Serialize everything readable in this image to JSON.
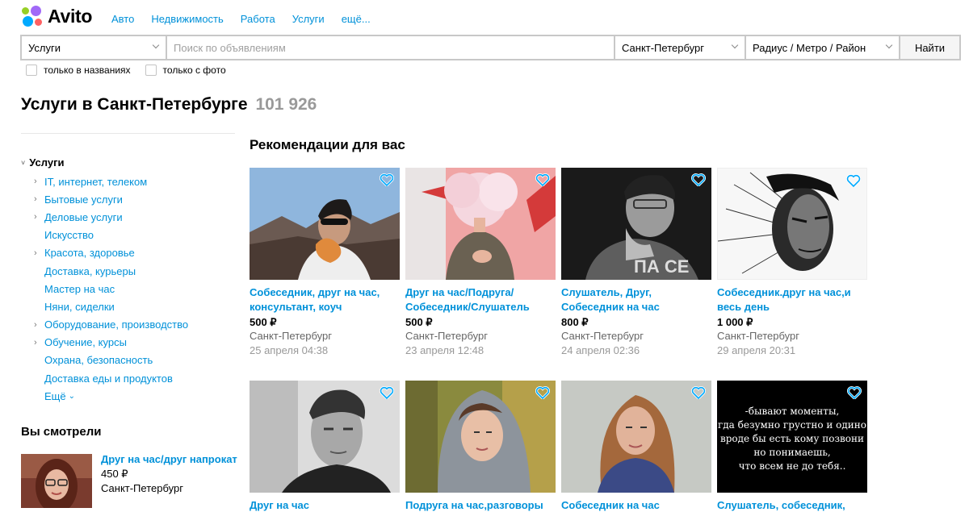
{
  "brand": {
    "name": "Avito"
  },
  "nav": [
    "Авто",
    "Недвижимость",
    "Работа",
    "Услуги",
    "ещё..."
  ],
  "search": {
    "category": "Услуги",
    "placeholder": "Поиск по объявлениям",
    "city": "Санкт-Петербург",
    "radius": "Радиус / Метро / Район",
    "button": "Найти"
  },
  "filters": {
    "names_only": "только в названиях",
    "with_photo": "только с фото"
  },
  "page": {
    "title": "Услуги в Санкт-Петербурге",
    "count": "101 926"
  },
  "sidebar": {
    "root": "Услуги",
    "items": [
      {
        "label": "IT, интернет, телеком",
        "arrow": true
      },
      {
        "label": "Бытовые услуги",
        "arrow": true
      },
      {
        "label": "Деловые услуги",
        "arrow": true
      },
      {
        "label": "Искусство",
        "arrow": false
      },
      {
        "label": "Красота, здоровье",
        "arrow": true
      },
      {
        "label": "Доставка, курьеры",
        "arrow": false
      },
      {
        "label": "Мастер на час",
        "arrow": false
      },
      {
        "label": "Няни, сиделки",
        "arrow": false
      },
      {
        "label": "Оборудование, производство",
        "arrow": true
      },
      {
        "label": "Обучение, курсы",
        "arrow": true
      },
      {
        "label": "Охрана, безопасность",
        "arrow": false
      },
      {
        "label": "Доставка еды и продуктов",
        "arrow": false
      }
    ],
    "more": "Ещё"
  },
  "viewed": {
    "heading": "Вы смотрели",
    "item": {
      "title": "Друг на час/друг напрокат",
      "price": "450 ₽",
      "city": "Санкт-Петербург"
    }
  },
  "recommendations": {
    "heading": "Рекомендации для вас",
    "row1": [
      {
        "title": "Собеседник, друг на час, консультант, коуч",
        "price": "500 ₽",
        "city": "Санкт-Петербург",
        "date": "25 апреля 04:38"
      },
      {
        "title": "Друг на час/Подруга/ Собеседник/Слушатель",
        "price": "500 ₽",
        "city": "Санкт-Петербург",
        "date": "23 апреля 12:48"
      },
      {
        "title": "Слушатель, Друг, Собеседник на час",
        "price": "800 ₽",
        "city": "Санкт-Петербург",
        "date": "24 апреля 02:36"
      },
      {
        "title": "Собеседник.друг на час,и весь день",
        "price": "1 000 ₽",
        "city": "Санкт-Петербург",
        "date": "29 апреля 20:31"
      }
    ],
    "row2": [
      {
        "title": "Друг на час"
      },
      {
        "title": "Подруга на час,разговоры"
      },
      {
        "title": "Собеседник на час"
      },
      {
        "title": "Слушатель, собеседник,",
        "quote": [
          "-бывают моменты,",
          "гда безумно грустно и одино",
          "вроде бы есть кому позвони",
          "но понимаешь,",
          "что всем не до тебя.."
        ]
      }
    ]
  },
  "colors": {
    "link": "#0091d9",
    "muted": "#999999",
    "heart": "#0af"
  }
}
